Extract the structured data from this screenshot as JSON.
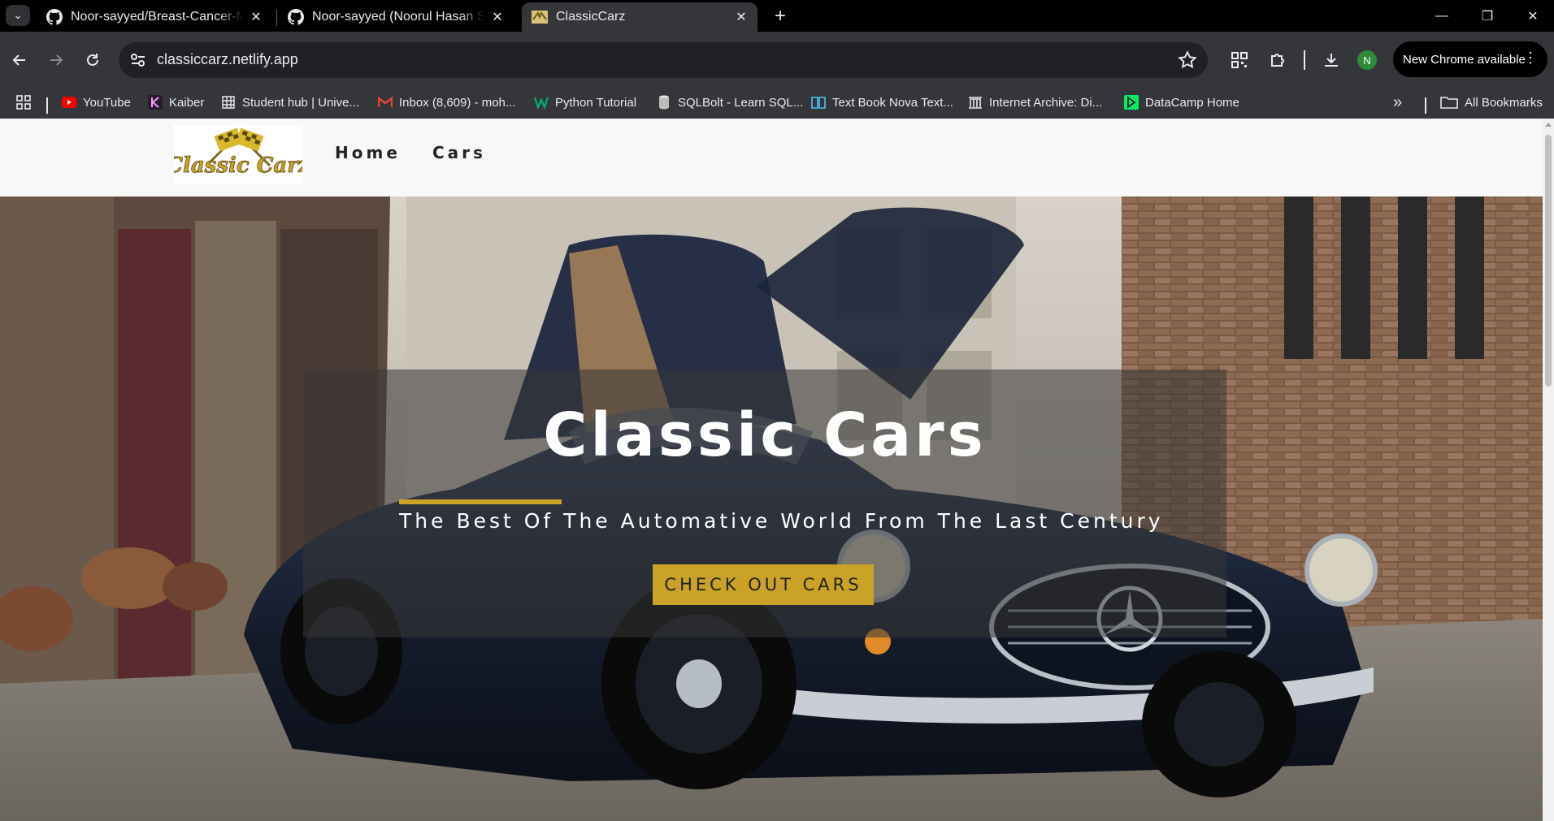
{
  "browser": {
    "tabs": [
      {
        "title": "Noor-sayyed/Breast-Cancer-Mo",
        "icon": "github-icon",
        "active": false
      },
      {
        "title": "Noor-sayyed (Noorul Hasan Sa",
        "icon": "github-icon",
        "active": false
      },
      {
        "title": "ClassicCarz",
        "icon": "classiccarz-favicon",
        "active": true
      }
    ],
    "address": "classiccarz.netlify.app",
    "new_chrome_label": "New Chrome available",
    "profile_initial": "N",
    "bookmarks": [
      {
        "label": "YouTube",
        "icon": "youtube-icon",
        "color": "#ff0000"
      },
      {
        "label": "Kaiber",
        "icon": "kaiber-icon",
        "color": "#e8eaed"
      },
      {
        "label": "Student hub | Unive...",
        "icon": "student-hub-icon",
        "color": "#e8eaed"
      },
      {
        "label": "Inbox (8,609) - moh...",
        "icon": "gmail-icon",
        "color": "#ea4335"
      },
      {
        "label": "Python Tutorial",
        "icon": "w3schools-icon",
        "color": "#04aa6d"
      },
      {
        "label": "SQLBolt - Learn SQL...",
        "icon": "database-icon",
        "color": "#e8eaed"
      },
      {
        "label": "Text Book Nova Text...",
        "icon": "book-icon",
        "color": "#4fc3f7"
      },
      {
        "label": "Internet Archive: Di...",
        "icon": "archive-icon",
        "color": "#e8eaed"
      },
      {
        "label": "DataCamp Home",
        "icon": "datacamp-icon",
        "color": "#03ef62"
      }
    ],
    "all_bookmarks_label": "All Bookmarks"
  },
  "site": {
    "logo_text": "Classic Carz",
    "nav": [
      {
        "label": "Home"
      },
      {
        "label": "Cars"
      }
    ],
    "hero": {
      "title": "Classic Cars",
      "subtitle": "The Best Of The Automative World From The Last Century",
      "cta": "CHECK OUT CARS"
    },
    "accent_color": "#c9a227"
  }
}
